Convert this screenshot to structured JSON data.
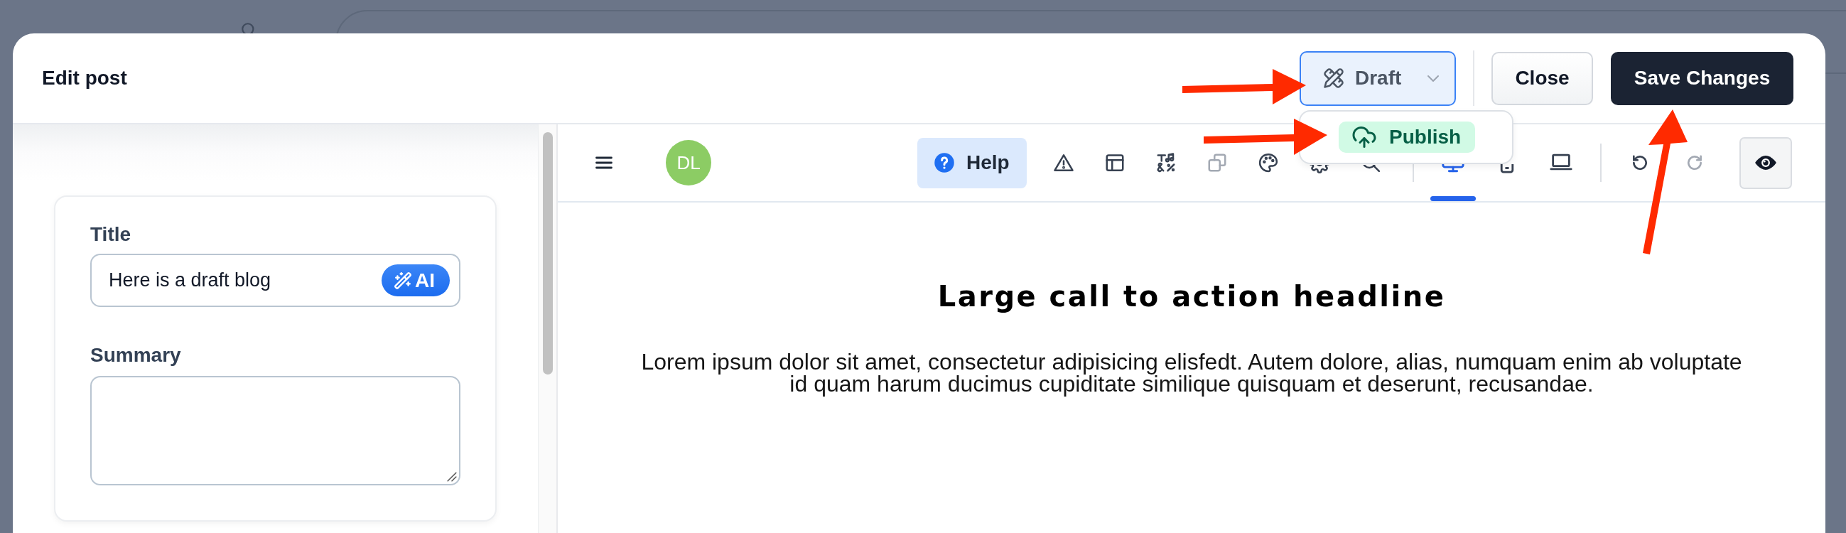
{
  "modal": {
    "title": "Edit post"
  },
  "status": {
    "label": "Draft",
    "expanded": true,
    "options": [
      {
        "label": "Publish"
      }
    ]
  },
  "actions": [
    {
      "label": "Close",
      "kind": "secondary"
    },
    {
      "label": "Save Changes",
      "kind": "primary"
    }
  ],
  "form": {
    "fields": [
      {
        "kind": "input",
        "label": "Title",
        "value": "Here is a draft blog",
        "assist": "AI"
      },
      {
        "kind": "textarea",
        "label": "Summary"
      }
    ]
  },
  "toolbar": {
    "avatar": "DL",
    "help": "Help",
    "tools": [
      {
        "disabled": false
      },
      {
        "disabled": false
      },
      {
        "disabled": false
      },
      {
        "disabled": true
      },
      {
        "disabled": false
      },
      {
        "disabled": false
      },
      {
        "disabled": false
      }
    ],
    "devices": [
      {
        "selected": true
      },
      {
        "selected": false
      },
      {
        "selected": false
      }
    ],
    "history": [
      {
        "disabled": false
      },
      {
        "disabled": true
      }
    ]
  },
  "canvas": {
    "headline": "Large call to action headline",
    "body": "Lorem ipsum dolor sit amet, consectetur adipisicing elisfedt. Autem dolore, alias, numquam enim ab voluptate id quam harum ducimus cupiditate similique quisquam et deserunt, recusandae."
  }
}
